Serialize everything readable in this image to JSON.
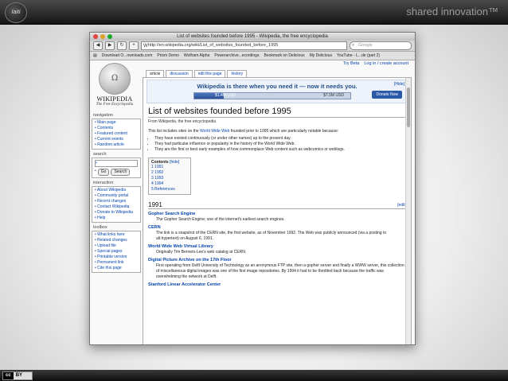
{
  "slide": {
    "logo_text": "Iaiti",
    "tagline": "shared innovation™",
    "license": {
      "cc": "cc",
      "by": "BY"
    }
  },
  "window": {
    "title": "List of websites founded before 1995 - Wikipedia, the free encyclopedia",
    "url": "http://en.wikipedia.org/wiki/List_of_websites_founded_before_1995",
    "search_placeholder": "Google",
    "bookmarks": [
      "Download O...ownloads.com",
      "Prism Demo",
      "Wolfram Alpha",
      "Powerarchive...ecordings",
      "Bookmark on Delicious",
      "My Delicious",
      "YouTube - L...de (part 2)"
    ]
  },
  "wiki": {
    "logo_name": "WIKIPEDIA",
    "logo_sub": "The Free Encyclopedia",
    "user_links": [
      "Try Beta",
      "Log in / create account"
    ],
    "tabs": [
      "article",
      "discussion",
      "edit this page",
      "history"
    ],
    "nav_heading": "navigation",
    "nav": [
      "Main page",
      "Contents",
      "Featured content",
      "Current events",
      "Random article"
    ],
    "search_heading": "search",
    "search_go": "Go",
    "search_btn": "Search",
    "interaction_heading": "interaction",
    "interaction": [
      "About Wikipedia",
      "Community portal",
      "Recent changes",
      "Contact Wikipedia",
      "Donate to Wikipedia",
      "Help"
    ],
    "toolbox_heading": "toolbox",
    "toolbox": [
      "What links here",
      "Related changes",
      "Upload file",
      "Special pages",
      "Printable version",
      "Permanent link",
      "Cite this page"
    ]
  },
  "banner": {
    "hide": "[Hide]",
    "text": "Wikipedia is there when you need it — now it needs you.",
    "raised": "$1.4M USD",
    "goal": "$7.5M USD",
    "progress": 0.19,
    "donate": "Donate Now"
  },
  "article": {
    "title": "List of websites founded before 1995",
    "from": "From Wikipedia, the free encyclopedia",
    "intro_pre": "This list includes sites on the ",
    "intro_link": "World Wide Web",
    "intro_post": " founded prior to 1995 which are particularly notable because:",
    "bullets": [
      "They have existed continuously (or under other names) up to the present day.",
      "They had particular influence or popularity in the history of the World Wide Web.",
      "They are the first or best early examples of how commonplace Web content such as webcomics or weblogs."
    ],
    "toc_title": "Contents",
    "toc_hide": "[hide]",
    "toc": [
      "1 1991",
      "2 1992",
      "3 1993",
      "4 1994",
      "5 References"
    ],
    "section": "1991",
    "edit": "[edit]",
    "entries": [
      {
        "title": "Gopher Search Engine",
        "body": "The Gopher Search Engine; one of the internet's earliest search engines."
      },
      {
        "title": "CERN",
        "body": "The link is a snapshot of the CERN site, the first website, as of November 1992. The Web was publicly announced (via a posting to alt.hypertext) on August 6, 1991."
      },
      {
        "title": "World Wide Web Virtual Library",
        "body": "Originally Tim Berners-Lee's web catalog at CERN."
      },
      {
        "title": "Digital Picture Archive on the 17th Floor",
        "body": "First operating from Delft University of Technology as an anonymous FTP site, then a gopher server and finally a WWW server, this collection of miscellaneous digital images was one of the first image repositories. By 1994 it had to be throttled back because the traffic was overwhelming the network at Delft."
      },
      {
        "title": "Stanford Linear Accelerator Center",
        "body": ""
      }
    ]
  },
  "colors": {
    "link": "#0645ad",
    "banner_text": "#1f4d8a",
    "donate": "#2d5aa8"
  }
}
